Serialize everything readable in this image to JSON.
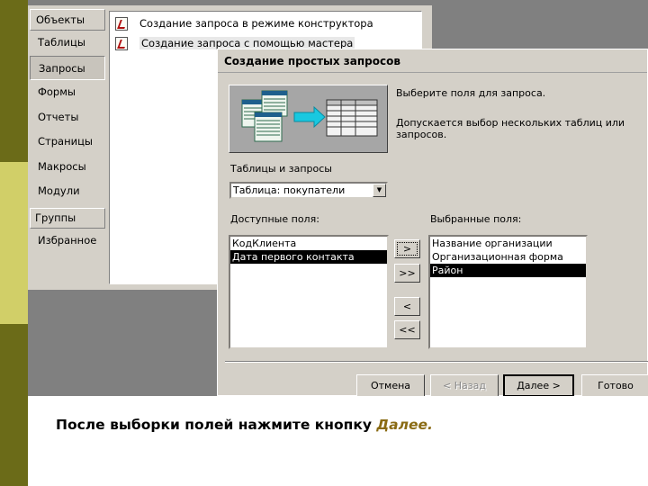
{
  "access_window": {
    "nav": {
      "header": "Объекты",
      "items": [
        "Таблицы",
        "Запросы",
        "Формы",
        "Отчеты",
        "Страницы",
        "Макросы",
        "Модули"
      ],
      "active_item": "Запросы",
      "groups_header": "Группы",
      "groups_items": [
        "Избранное"
      ]
    },
    "objects": [
      {
        "label": "Создание запроса в режиме конструктора",
        "icon": "query-design-icon"
      },
      {
        "label": "Создание запроса с помощью мастера",
        "icon": "query-wizard-icon"
      }
    ]
  },
  "wizard": {
    "title": "Создание простых запросов",
    "instruction1": "Выберите поля для запроса.",
    "instruction2": "Допускается выбор нескольких таблиц или запросов.",
    "tables_label": "Таблицы и запросы",
    "tables_value": "Таблица: покупатели",
    "available_label": "Доступные поля:",
    "selected_label": "Выбранные поля:",
    "available_fields": [
      "КодКлиента",
      "Дата первого контакта"
    ],
    "available_highlight": 1,
    "selected_fields": [
      "Название организации",
      "Организационная форма",
      "Район"
    ],
    "selected_highlight": 2,
    "move_buttons": [
      ">",
      ">>",
      "<",
      "<<"
    ],
    "buttons": {
      "cancel": "Отмена",
      "back": "< Назад",
      "next": "Далее >",
      "finish": "Готово"
    }
  },
  "caption": {
    "text": "После выборки полей нажмите кнопку ",
    "accent": "Далее."
  },
  "colors": {
    "stripe_dark": "#6b6b18",
    "stripe_light": "#d1cf68",
    "dialog_face": "#d4d0c8",
    "accent_text": "#8a6b14"
  }
}
